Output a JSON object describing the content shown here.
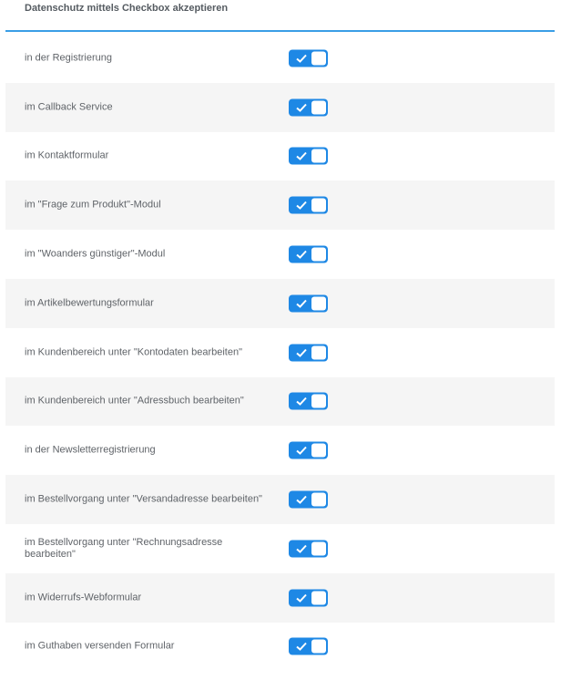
{
  "header": {
    "title": "Datenschutz mittels Checkbox akzeptieren"
  },
  "colors": {
    "accent": "#1e88e5",
    "divider": "#3a9ee6",
    "row_alt": "#f5f5f5",
    "text": "#5f6368"
  },
  "toggle_icon": "check-icon",
  "rows": [
    {
      "label": "in der Registrierung",
      "enabled": true
    },
    {
      "label": "im Callback Service",
      "enabled": true
    },
    {
      "label": "im Kontaktformular",
      "enabled": true
    },
    {
      "label": "im \"Frage zum Produkt\"-Modul",
      "enabled": true
    },
    {
      "label": "im \"Woanders günstiger\"-Modul",
      "enabled": true
    },
    {
      "label": "im Artikelbewertungsformular",
      "enabled": true
    },
    {
      "label": "im Kundenbereich unter \"Kontodaten bearbeiten\"",
      "enabled": true
    },
    {
      "label": "im Kundenbereich unter \"Adressbuch bearbeiten\"",
      "enabled": true
    },
    {
      "label": "in der Newsletterregistrierung",
      "enabled": true
    },
    {
      "label": "im Bestellvorgang unter \"Versandadresse bearbeiten\"",
      "enabled": true
    },
    {
      "label": "im Bestellvorgang unter \"Rechnungsadresse bearbeiten\"",
      "enabled": true
    },
    {
      "label": "im Widerrufs-Webformular",
      "enabled": true
    },
    {
      "label": "im Guthaben versenden Formular",
      "enabled": true
    }
  ]
}
